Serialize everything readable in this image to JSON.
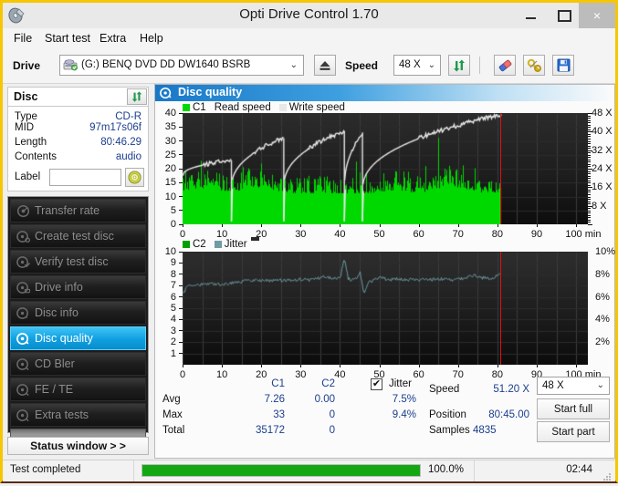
{
  "window": {
    "title": "Opti Drive Control 1.70",
    "icon": "disc-icon",
    "minimize": "minimize-icon",
    "maximize": "maximize-icon",
    "close": "×"
  },
  "menu": [
    {
      "label": "File"
    },
    {
      "label": "Start test"
    },
    {
      "label": "Extra"
    },
    {
      "label": "Help"
    }
  ],
  "toolbar": {
    "drive_label": "Drive",
    "drive_value": "(G:)   BENQ DVD DD DW1640 BSRB",
    "drive_icon": "drive-icon",
    "drive_arrow": "⌄",
    "eject_icon": "eject-icon",
    "speed_label": "Speed",
    "speed_value": "48 X",
    "speed_arrow": "⌄",
    "refresh_icon": "refresh-arrows-icon",
    "erase_icon": "eraser-icon",
    "tools_icon": "tools-icon",
    "save_icon": "floppy-save-icon"
  },
  "sidebar": {
    "disc_panel_title": "Disc",
    "disc_refresh_icon": "refresh-arrows-icon",
    "disc_rows": [
      {
        "key": "Type",
        "value": "CD-R"
      },
      {
        "key": "MID",
        "value": "97m17s06f"
      },
      {
        "key": "Length",
        "value": "80:46.29"
      },
      {
        "key": "Contents",
        "value": "audio"
      }
    ],
    "label_key": "Label",
    "label_value": "",
    "label_placeholder": "",
    "label_button_icon": "cd-disc-icon",
    "items": [
      {
        "label": "Transfer rate",
        "icon": "disc-speed-icon",
        "active": false
      },
      {
        "label": "Create test disc",
        "icon": "disc-write-icon",
        "active": false
      },
      {
        "label": "Verify test disc",
        "icon": "disc-verify-icon",
        "active": false
      },
      {
        "label": "Drive info",
        "icon": "disc-drive-icon",
        "active": false
      },
      {
        "label": "Disc info",
        "icon": "disc-info-icon",
        "active": false
      },
      {
        "label": "Disc quality",
        "icon": "disc-quality-icon",
        "active": true
      },
      {
        "label": "CD Bler",
        "icon": "disc-bler-icon",
        "active": false
      },
      {
        "label": "FE / TE",
        "icon": "disc-fete-icon",
        "active": false
      },
      {
        "label": "Extra tests",
        "icon": "disc-extra-icon",
        "active": false
      }
    ],
    "status_window_button": "Status window > >"
  },
  "main": {
    "header_title": "Disc quality",
    "header_icon": "disc-quality-icon"
  },
  "chart_data": [
    {
      "type": "area",
      "id": "c1-read-write-speed",
      "title": "",
      "xlabel": "min",
      "ylabel": "",
      "xlim": [
        0,
        103
      ],
      "ylim": [
        0,
        40
      ],
      "y2lim": [
        0,
        48
      ],
      "grid": true,
      "legend_position": "top-left",
      "xticks": [
        0,
        10,
        20,
        30,
        40,
        50,
        60,
        70,
        80,
        90,
        100
      ],
      "xtick_labels": [
        "0",
        "10",
        "20",
        "30",
        "40",
        "50",
        "60",
        "70",
        "80",
        "90",
        "100 min"
      ],
      "yticks": [
        0,
        5,
        10,
        15,
        20,
        25,
        30,
        35,
        40
      ],
      "y2ticks": [
        8,
        16,
        24,
        32,
        40,
        48
      ],
      "y2tick_labels": [
        "8 X",
        "16 X",
        "24 X",
        "32 X",
        "40 X",
        "48 X"
      ],
      "marker_position_min": 80.75,
      "marker_color": "#e21010",
      "data_end_min": 80.9,
      "series": [
        {
          "name": "C1",
          "color": "#00d900",
          "kind": "impulse-area",
          "baseline_mean": 11.5,
          "noise_min": 8,
          "noise_max": 26,
          "spike_max": 33
        },
        {
          "name": "Read speed",
          "color": "#ffffff",
          "kind": "line-absent",
          "values": []
        },
        {
          "name": "Write speed",
          "color": "#e8e8e8",
          "kind": "staircase",
          "description": "CAV/P-CAV ramp with 4 speed-step resets",
          "breakpoints_min": [
            0,
            12.3,
            25.6,
            41.0,
            45.6,
            80.9
          ],
          "segment_start_y": [
            17.5,
            12.8,
            13.0,
            12.5,
            12.0
          ],
          "segment_end_y": [
            23.0,
            31.0,
            33.5,
            32.5,
            39.5
          ]
        }
      ]
    },
    {
      "type": "line",
      "id": "c2-jitter",
      "title": "",
      "xlabel": "min",
      "ylabel": "",
      "xlim": [
        0,
        103
      ],
      "ylim": [
        0,
        10
      ],
      "y2lim": [
        0,
        10
      ],
      "grid": true,
      "legend_position": "top-left",
      "xticks": [
        0,
        10,
        20,
        30,
        40,
        50,
        60,
        70,
        80,
        90,
        100
      ],
      "xtick_labels": [
        "0",
        "10",
        "20",
        "30",
        "40",
        "50",
        "60",
        "70",
        "80",
        "90",
        "100 min"
      ],
      "yticks": [
        1,
        2,
        3,
        4,
        5,
        6,
        7,
        8,
        9,
        10
      ],
      "y2ticks": [
        2,
        4,
        6,
        8,
        10
      ],
      "y2tick_labels": [
        "2%",
        "4%",
        "6%",
        "8%",
        "10%"
      ],
      "marker_position_min": 80.75,
      "marker_color": "#e21010",
      "data_end_min": 80.9,
      "series": [
        {
          "name": "C2",
          "color": "#00a000",
          "kind": "impulse",
          "values": []
        },
        {
          "name": "Jitter",
          "color": "#6f9ba3",
          "kind": "line",
          "mean": 7.5,
          "min": 6.2,
          "max": 9.45,
          "x": [
            0,
            1,
            2,
            4,
            6,
            8,
            10,
            12,
            14,
            16,
            18,
            20,
            22,
            24,
            26,
            28,
            30,
            32,
            34,
            36,
            38,
            40,
            41,
            42,
            43,
            44,
            45,
            46,
            47,
            48,
            50,
            52,
            54,
            56,
            58,
            60,
            62,
            64,
            66,
            68,
            70,
            72,
            74,
            76,
            78,
            80.9
          ],
          "values": [
            6.2,
            6.9,
            7.0,
            7.05,
            7.1,
            7.15,
            7.1,
            7.2,
            7.3,
            7.45,
            7.5,
            7.45,
            7.4,
            7.5,
            7.45,
            7.5,
            7.55,
            7.5,
            7.6,
            7.75,
            7.6,
            7.8,
            9.45,
            7.6,
            7.5,
            7.6,
            8.2,
            6.25,
            7.2,
            7.4,
            7.75,
            7.5,
            7.6,
            7.5,
            7.55,
            7.5,
            7.6,
            7.5,
            7.6,
            7.5,
            7.55,
            7.7,
            7.9,
            7.7,
            7.6,
            8.05
          ]
        }
      ]
    }
  ],
  "stats": {
    "col_headers": [
      "C1",
      "C2"
    ],
    "row_labels": [
      "Avg",
      "Max",
      "Total"
    ],
    "c1": [
      "7.26",
      "33",
      "35172"
    ],
    "c2": [
      "0.00",
      "0",
      "0"
    ],
    "jitter_label": "Jitter",
    "jitter_checked": true,
    "jitter_check_glyph": "✔",
    "jitter_values": [
      "7.5%",
      "9.4%"
    ],
    "speed_label": "Speed",
    "speed_value": "51.20 X",
    "position_label": "Position",
    "position_value": "80:45.00",
    "samples_label": "Samples",
    "samples_value": "4835",
    "speed_select_value": "48 X",
    "speed_select_arrow": "⌄",
    "start_full_label": "Start full",
    "start_part_label": "Start part"
  },
  "statusbar": {
    "text": "Test completed",
    "progress_percent": 100.0,
    "progress_label": "100.0%",
    "elapsed": "02:44",
    "progress_color": "#13a813",
    "grip_icon": "resize-grip-icon"
  }
}
